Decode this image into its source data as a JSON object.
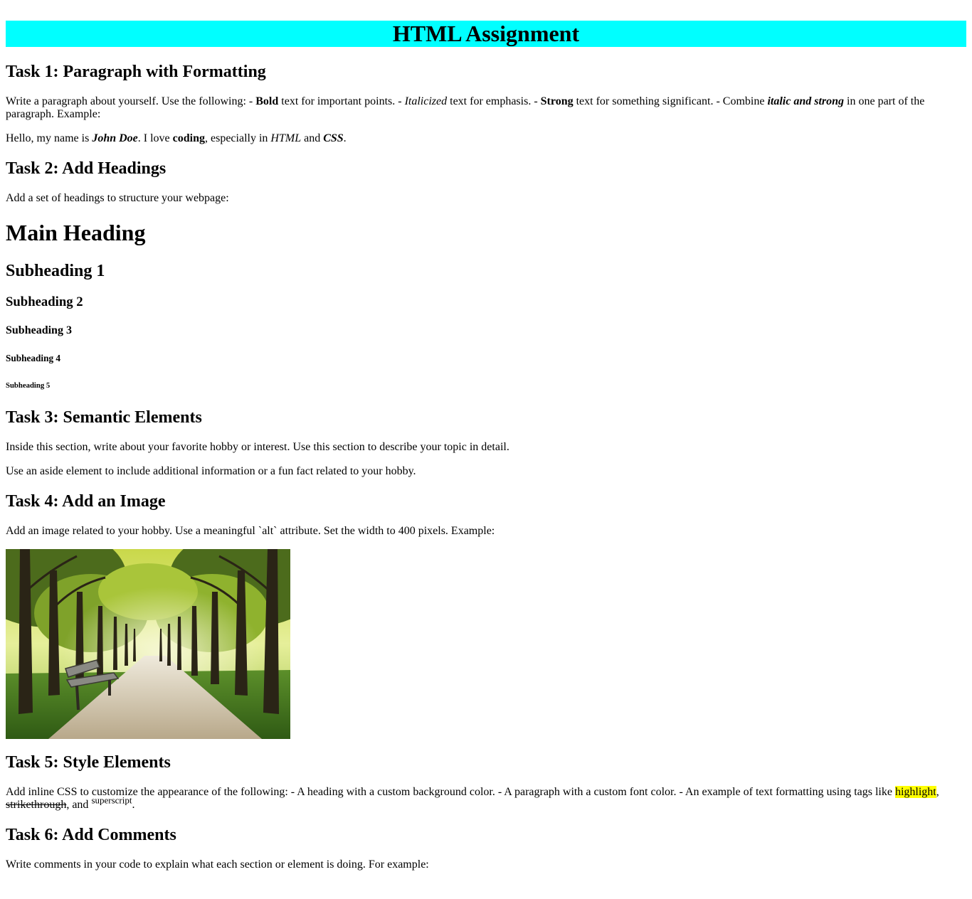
{
  "title": "HTML Assignment",
  "task1": {
    "heading": "Task 1: Paragraph with Formatting",
    "instructions": {
      "t1": "Write a paragraph about yourself. Use the following: - ",
      "bold": "Bold",
      "t2": " text for important points. - ",
      "italic": "Italicized",
      "t3": " text for emphasis. - ",
      "strong": "Strong",
      "t4": " text for something significant. - Combine ",
      "italic_strong": "italic and strong",
      "t5": " in one part of the paragraph. Example:"
    },
    "example": {
      "t1": "Hello, my name is ",
      "name": "John Doe",
      "t2": ". I love ",
      "coding": "coding",
      "t3": ", especially in ",
      "html": "HTML",
      "t4": " and ",
      "css": "CSS",
      "t5": "."
    }
  },
  "task2": {
    "heading": "Task 2: Add Headings",
    "intro": "Add a set of headings to structure your webpage:",
    "headings": {
      "main": "Main Heading",
      "sub1": "Subheading 1",
      "sub2": "Subheading 2",
      "sub3": "Subheading 3",
      "sub4": "Subheading 4",
      "sub5": "Subheading 5"
    }
  },
  "task3": {
    "heading": "Task 3: Semantic Elements",
    "p1": "Inside this section, write about your favorite hobby or interest. Use this section to describe your topic in detail.",
    "p2": "Use an aside element to include additional information or a fun fact related to your hobby."
  },
  "task4": {
    "heading": "Task 4: Add an Image",
    "intro": "Add an image related to your hobby. Use a meaningful `alt` attribute. Set the width to 400 pixels. Example:"
  },
  "task5": {
    "heading": "Task 5: Style Elements",
    "t1": "Add inline CSS to customize the appearance of the following: - A heading with a custom background color. - A paragraph with a custom font color. - An example of text formatting using tags like ",
    "highlight": "highlight",
    "t2": ", ",
    "strikethrough": "strikethrough",
    "t3": ", and ",
    "superscript": "superscript",
    "t4": "."
  },
  "task6": {
    "heading": "Task 6: Add Comments",
    "intro": "Write comments in your code to explain what each section or element is doing. For example:"
  },
  "colors": {
    "title_background": "#00ffff",
    "highlight": "#ffff00"
  }
}
